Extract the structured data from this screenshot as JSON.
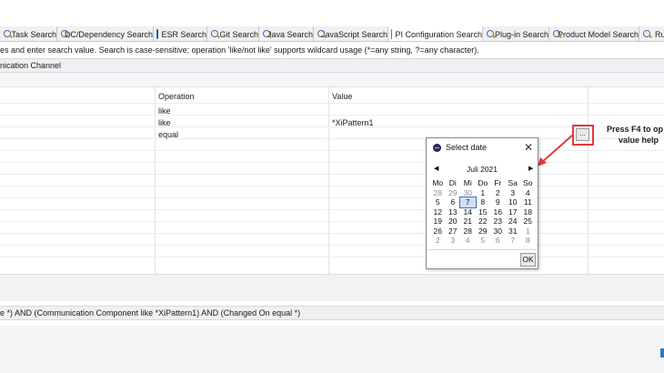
{
  "tabs": [
    {
      "label": "Task Search",
      "icon": "search-icon"
    },
    {
      "label": "DC/Dependency Search",
      "icon": "search-icon"
    },
    {
      "label": "ESR Search",
      "icon": "esr-icon"
    },
    {
      "label": "Git Search",
      "icon": "search-icon"
    },
    {
      "label": "Java Search",
      "icon": "search-icon"
    },
    {
      "label": "JavaScript Search",
      "icon": "search-icon"
    },
    {
      "label": "PI Configuration Search",
      "icon": "pi-icon"
    },
    {
      "label": "Plug-in Search",
      "icon": "search-icon"
    },
    {
      "label": "Product Model Search",
      "icon": "search-icon"
    },
    {
      "label": "Ru",
      "icon": "search-icon"
    }
  ],
  "info_text": "es and enter search value. Search is case-sensitive; operation 'like/not like' supports wildcard usage (*=any string, ?=any character).",
  "section_title": "nication Channel",
  "grid": {
    "headers": {
      "operation": "Operation",
      "value": "Value"
    },
    "rows": [
      {
        "operation": "like",
        "value": ""
      },
      {
        "operation": "like",
        "value": "*XiPattern1"
      },
      {
        "operation": "equal",
        "value": ""
      }
    ]
  },
  "value_help_button": "...",
  "callout": {
    "line1": "Press F4 to op",
    "line2": "value help"
  },
  "query_text": "e *) AND (Communication Component like *XiPattern1) AND (Changed On equal *)",
  "dialog": {
    "title": "Select date",
    "close": "✕",
    "prev": "◀",
    "next": "▶",
    "month": "Juli 2021",
    "weekdays": [
      "Mo",
      "Di",
      "Mi",
      "Do",
      "Fr",
      "Sa",
      "So"
    ],
    "weeks": [
      [
        {
          "d": "28",
          "o": true
        },
        {
          "d": "29",
          "o": true
        },
        {
          "d": "30",
          "o": true
        },
        {
          "d": "1"
        },
        {
          "d": "2"
        },
        {
          "d": "3"
        },
        {
          "d": "4"
        }
      ],
      [
        {
          "d": "5"
        },
        {
          "d": "6"
        },
        {
          "d": "7",
          "s": true
        },
        {
          "d": "8"
        },
        {
          "d": "9"
        },
        {
          "d": "10"
        },
        {
          "d": "11"
        }
      ],
      [
        {
          "d": "12"
        },
        {
          "d": "13"
        },
        {
          "d": "14"
        },
        {
          "d": "15"
        },
        {
          "d": "16"
        },
        {
          "d": "17"
        },
        {
          "d": "18"
        }
      ],
      [
        {
          "d": "19"
        },
        {
          "d": "20"
        },
        {
          "d": "21"
        },
        {
          "d": "22"
        },
        {
          "d": "23"
        },
        {
          "d": "24"
        },
        {
          "d": "25"
        }
      ],
      [
        {
          "d": "26"
        },
        {
          "d": "27"
        },
        {
          "d": "28"
        },
        {
          "d": "29"
        },
        {
          "d": "30"
        },
        {
          "d": "31"
        },
        {
          "d": "1",
          "o": true
        }
      ],
      [
        {
          "d": "2",
          "o": true
        },
        {
          "d": "3",
          "o": true
        },
        {
          "d": "4",
          "o": true
        },
        {
          "d": "5",
          "o": true
        },
        {
          "d": "6",
          "o": true
        },
        {
          "d": "7",
          "o": true
        },
        {
          "d": "8",
          "o": true
        }
      ]
    ],
    "ok_label": "OK"
  },
  "colors": {
    "highlight": "#e23a3a",
    "selected_day": "#cfe0f6"
  }
}
